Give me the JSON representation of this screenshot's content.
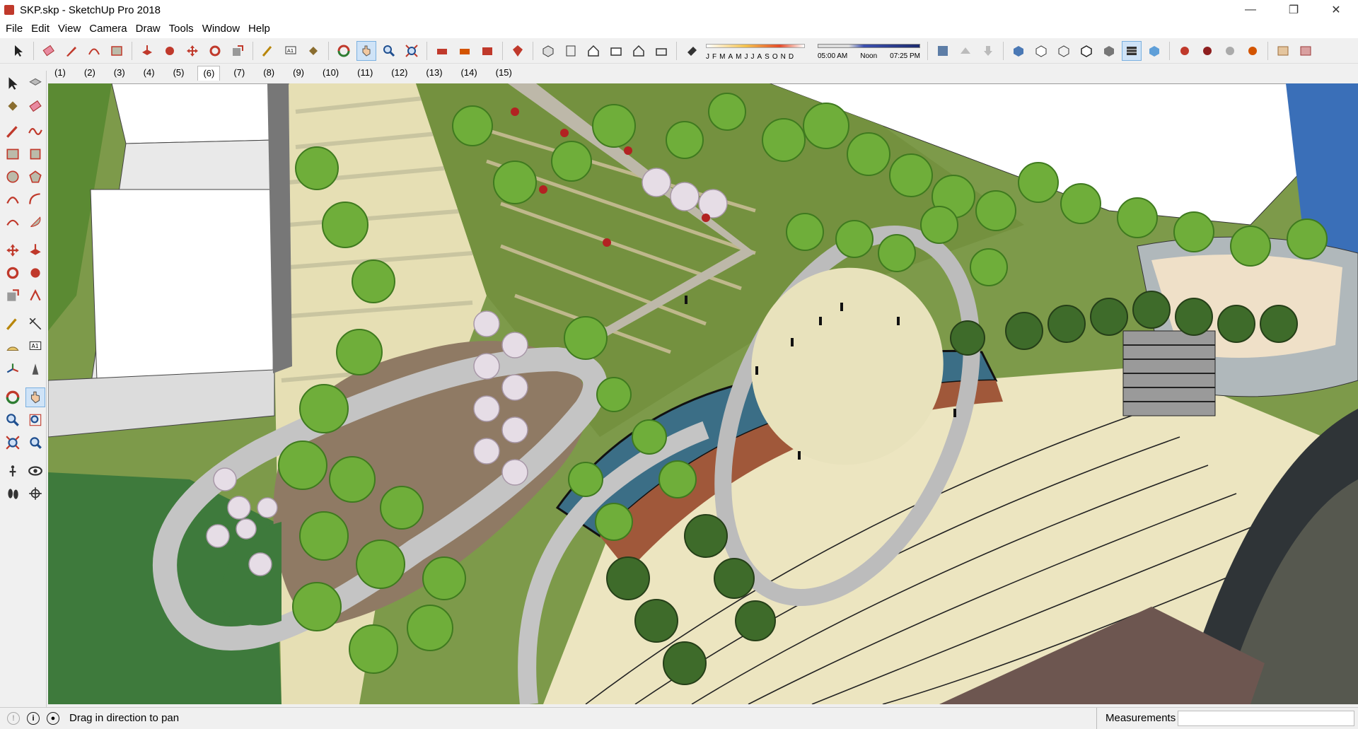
{
  "window": {
    "title": "SKP.skp - SketchUp Pro 2018",
    "minimize_glyph": "—",
    "maximize_glyph": "❐",
    "close_glyph": "✕"
  },
  "menu": {
    "items": [
      "File",
      "Edit",
      "View",
      "Camera",
      "Draw",
      "Tools",
      "Window",
      "Help"
    ]
  },
  "toolbar": {
    "months": [
      "J",
      "F",
      "M",
      "A",
      "M",
      "J",
      "J",
      "A",
      "S",
      "O",
      "N",
      "D"
    ],
    "time_start": "05:00 AM",
    "time_mid": "Noon",
    "time_end": "07:25 PM"
  },
  "scenes": {
    "tabs": [
      "(1)",
      "(2)",
      "(3)",
      "(4)",
      "(5)",
      "(6)",
      "(7)",
      "(8)",
      "(9)",
      "(10)",
      "(11)",
      "(12)",
      "(13)",
      "(14)",
      "(15)"
    ],
    "active_index": 5
  },
  "status": {
    "hint": "Drag in direction to pan",
    "measurements_label": "Measurements",
    "measurements_value": ""
  },
  "colors": {
    "accent_active": "#cfe3f7",
    "grass": "#7d9a4a",
    "water": "#4a7d95",
    "paving": "#e8e3bd",
    "path": "#c9c9c9",
    "building": "#ffffff"
  },
  "icons": {
    "left_toolbar": [
      "select-icon",
      "component-icon",
      "paint-bucket-icon",
      "eraser-icon",
      "line-icon",
      "freehand-icon",
      "rectangle-icon",
      "rotated-rectangle-icon",
      "circle-icon",
      "polygon-icon",
      "arc-icon",
      "two-point-arc-icon",
      "three-point-arc-icon",
      "pie-icon",
      "move-icon",
      "push-pull-icon",
      "rotate-icon",
      "follow-me-icon",
      "scale-icon",
      "offset-icon",
      "tape-measure-icon",
      "dimension-icon",
      "protractor-icon",
      "text-icon",
      "axes-icon",
      "3d-text-icon",
      "orbit-icon",
      "pan-icon",
      "zoom-icon",
      "zoom-window-icon",
      "zoom-extents-icon",
      "position-camera-icon",
      "walk-icon",
      "look-around-icon",
      "footprints-icon",
      "section-plane-icon"
    ]
  }
}
